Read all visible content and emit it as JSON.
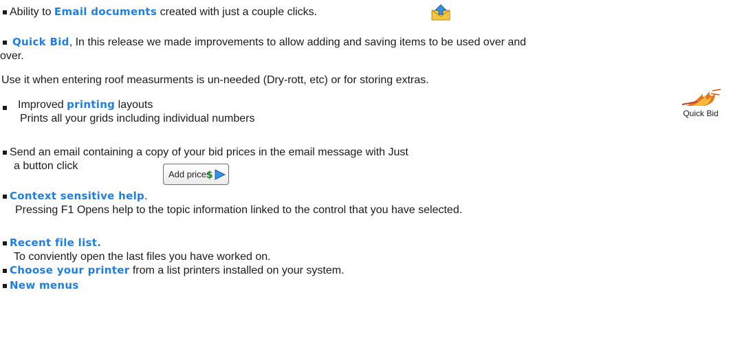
{
  "items": [
    {
      "link": "Email documents",
      "before": "Ability to ",
      "after": " created with just a couple clicks."
    },
    {
      "link": "Quick Bid",
      "after": ", In this release we made improvements to allow adding and saving items to be used over and",
      "continuation": "over."
    },
    {
      "plain": "Use it when entering roof measurments is un-needed (Dry-rott, etc) or for storing extras."
    },
    {
      "before": "Improved ",
      "link": "printing",
      "after": " layouts",
      "sub": "Prints all your grids including individual numbers"
    },
    {
      "text": "Send an email containing a copy of your bid prices in the email message with Just",
      "continuation": "a button click"
    },
    {
      "link": "Context sensitive help",
      "after": ".",
      "sub": "Pressing F1  Opens help to the topic information linked to the control that you have selected."
    },
    {
      "link": "Recent file list.",
      "sub": "To conviently open the last files you have worked on."
    },
    {
      "link": "Choose your printer",
      "after": " from a list printers installed on your system."
    },
    {
      "link": "New menus"
    }
  ],
  "quick_bid_icon": {
    "label": "Quick Bid"
  },
  "add_prices_button": {
    "label": "Add prices"
  },
  "colors": {
    "link": "#1f7fe0",
    "text": "#1a1a1a"
  },
  "icons": [
    "email-send-icon",
    "quick-bid-flame-icon",
    "dollar-icon",
    "arrow-right-icon"
  ]
}
